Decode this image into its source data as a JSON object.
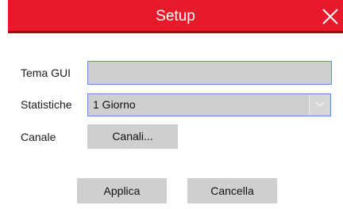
{
  "dialog": {
    "title": "Setup",
    "close_icon": "close-icon"
  },
  "form": {
    "theme_label": "Tema GUI",
    "theme_value": "",
    "stats_label": "Statistiche",
    "stats_value": "1 Giorno",
    "channel_label": "Canale",
    "channel_button": "Canali..."
  },
  "actions": {
    "apply": "Applica",
    "cancel": "Cancella"
  },
  "colors": {
    "titlebar": "#e8192b",
    "field_border": "#5b8fd6",
    "field_fill": "#cfcfcf"
  }
}
